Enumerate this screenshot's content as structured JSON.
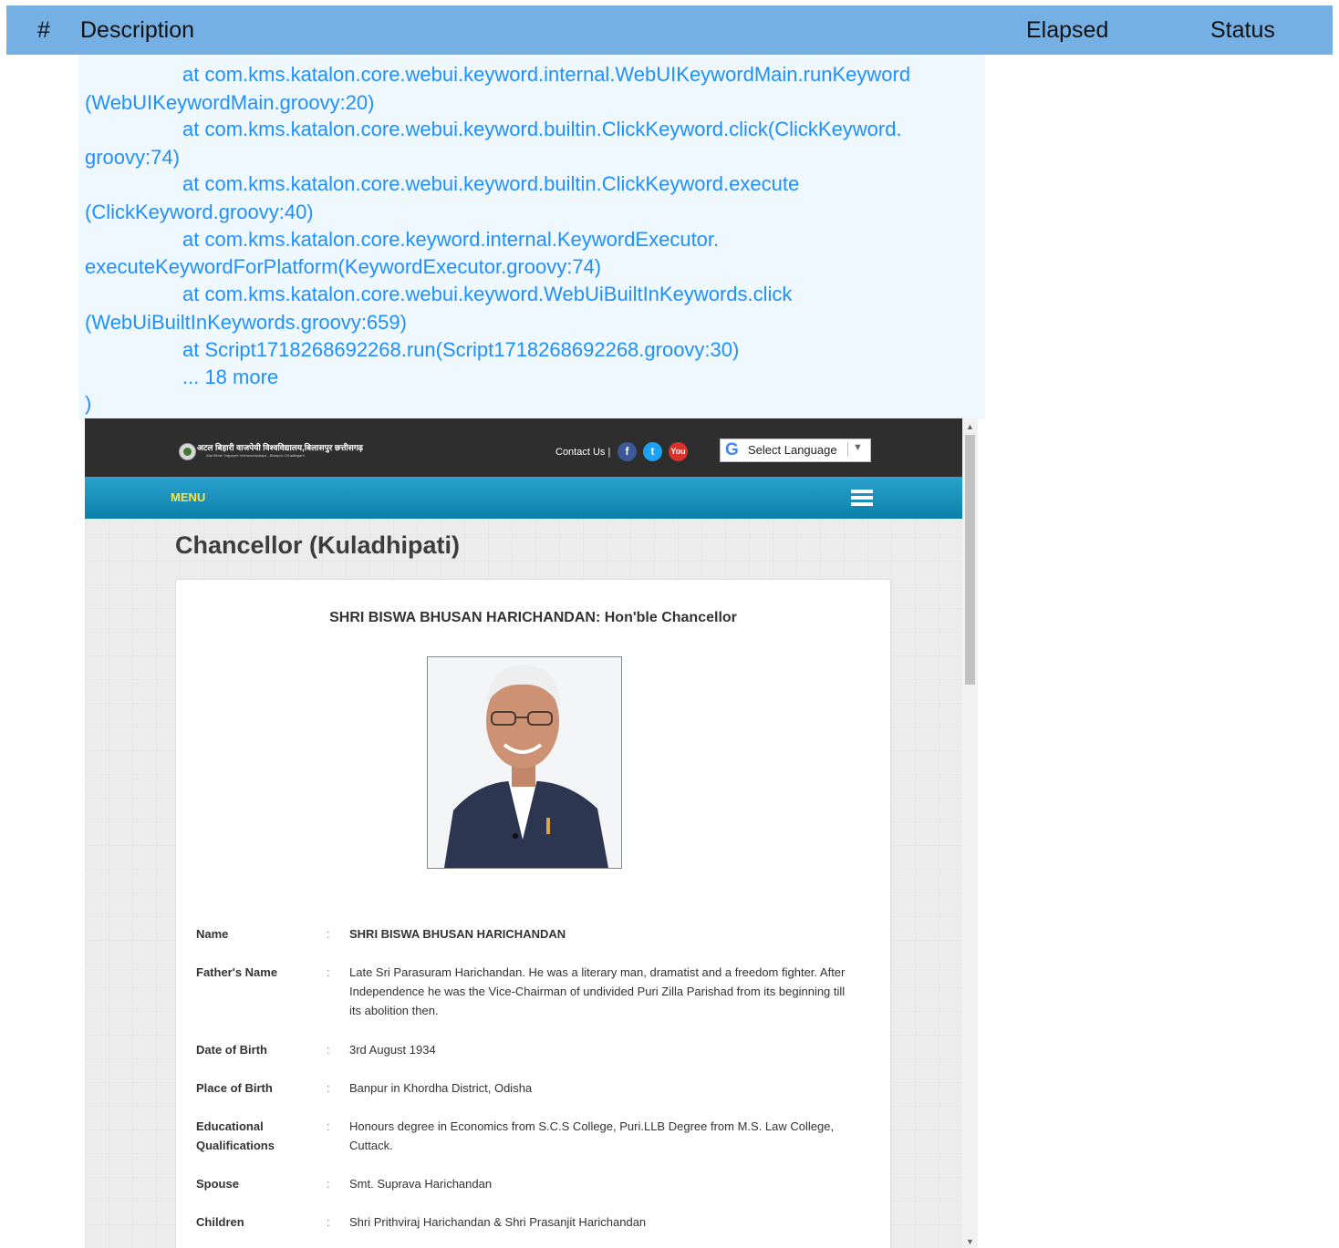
{
  "header": {
    "num": "#",
    "description": "Description",
    "elapsed": "Elapsed",
    "status": "Status"
  },
  "log": {
    "lines": [
      {
        "text": "at com.kms.katalon.core.webui.keyword.internal.WebUIKeywordMain.runKeyword",
        "indent": true
      },
      {
        "text": "(WebUIKeywordMain.groovy:20)",
        "indent": false
      },
      {
        "text": "at com.kms.katalon.core.webui.keyword.builtin.ClickKeyword.click(ClickKeyword.",
        "indent": true
      },
      {
        "text": "groovy:74)",
        "indent": false
      },
      {
        "text": "at com.kms.katalon.core.webui.keyword.builtin.ClickKeyword.execute",
        "indent": true
      },
      {
        "text": "(ClickKeyword.groovy:40)",
        "indent": false
      },
      {
        "text": "at com.kms.katalon.core.keyword.internal.KeywordExecutor.",
        "indent": true
      },
      {
        "text": "executeKeywordForPlatform(KeywordExecutor.groovy:74)",
        "indent": false
      },
      {
        "text": "at com.kms.katalon.core.webui.keyword.WebUiBuiltInKeywords.click",
        "indent": true
      },
      {
        "text": "(WebUiBuiltInKeywords.groovy:659)",
        "indent": false
      },
      {
        "text": "at Script1718268692268.run(Script1718268692268.groovy:30)",
        "indent": true
      },
      {
        "text": "... 18 more",
        "indent": true
      },
      {
        "text": ")",
        "indent": false
      }
    ]
  },
  "site": {
    "logo_text": "अटल बिहारी वाजपेयी विश्वविद्यालय,बिलासपुर छत्तीसगढ़",
    "logo_sub": "Atal Bihari Vajpayee Vishwavidyalaya , Bilaspur Chhattisgarh",
    "contact": "Contact Us |",
    "social": {
      "facebook": "f",
      "twitter": "t",
      "youtube": "You"
    },
    "language": "Select Language",
    "menu": "MENU",
    "page_title": "Chancellor (Kuladhipati)",
    "card_title": "SHRI BISWA BHUSAN HARICHANDAN: Hon'ble Chancellor",
    "separator": ":",
    "details": [
      {
        "label": "Name",
        "value": "SHRI BISWA BHUSAN HARICHANDAN"
      },
      {
        "label": "Father's Name",
        "value": "Late Sri Parasuram Harichandan. He was a literary man, dramatist and a freedom fighter. After Independence he was the Vice-Chairman of undivided Puri Zilla Parishad from its beginning till its abolition then."
      },
      {
        "label": "Date of Birth",
        "value": "3rd August 1934"
      },
      {
        "label": "Place of Birth",
        "value": "Banpur in Khordha District, Odisha"
      },
      {
        "label": "Educational Qualifications",
        "value": "Honours degree in Economics from S.C.S College, Puri.LLB Degree from M.S. Law College, Cuttack."
      },
      {
        "label": "Spouse",
        "value": "Smt. Suprava Harichandan"
      },
      {
        "label": "Children",
        "value": "Shri Prithviraj Harichandan & Shri Prasanjit Harichandan"
      }
    ]
  }
}
